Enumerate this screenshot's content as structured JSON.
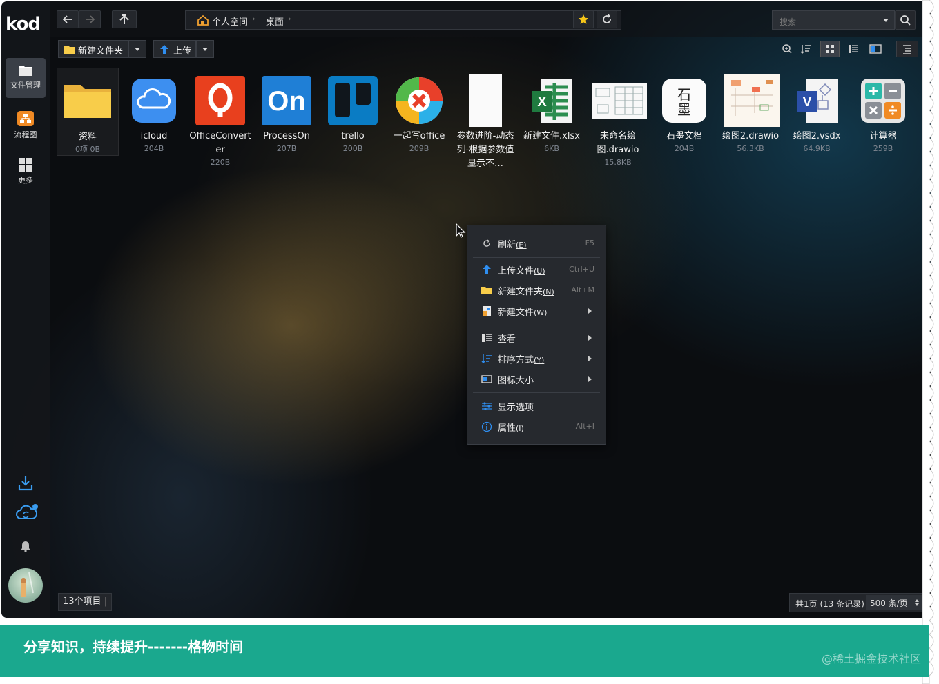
{
  "app": {
    "logo": "kod"
  },
  "sidebar": {
    "items": [
      {
        "label": "文件管理",
        "icon": "folder-icon"
      },
      {
        "label": "流程图",
        "icon": "flowchart-icon"
      },
      {
        "label": "更多",
        "icon": "grid-icon"
      }
    ],
    "bottom_icons": [
      "download-icon",
      "cloud-sync-icon",
      "bell-icon"
    ]
  },
  "breadcrumb": {
    "items": [
      "个人空间",
      "桌面"
    ]
  },
  "search": {
    "placeholder": "搜索"
  },
  "toolbar": {
    "new_folder": "新建文件夹",
    "upload": "上传"
  },
  "files": [
    {
      "name": "资料",
      "size": "0项 0B",
      "icon": "folder-icon"
    },
    {
      "name": "icloud",
      "size": "204B",
      "icon": "icloud-icon"
    },
    {
      "name": "OfficeConverter",
      "size": "220B",
      "icon": "officeconverter-icon"
    },
    {
      "name": "ProcessOn",
      "size": "207B",
      "icon": "processon-icon"
    },
    {
      "name": "trello",
      "size": "200B",
      "icon": "trello-icon"
    },
    {
      "name": "一起写office",
      "size": "209B",
      "icon": "yiqixie-icon"
    },
    {
      "name": "参数进阶-动态列-根据参数值显示不…",
      "size": "",
      "icon": "document-icon"
    },
    {
      "name": "新建文件.xlsx",
      "size": "6KB",
      "icon": "excel-icon"
    },
    {
      "name": "未命名绘图.drawio",
      "size": "15.8KB",
      "icon": "drawio-icon"
    },
    {
      "name": "石墨文档",
      "size": "204B",
      "icon": "shimo-icon"
    },
    {
      "name": "绘图2.drawio",
      "size": "56.3KB",
      "icon": "drawio-icon"
    },
    {
      "name": "绘图2.vsdx",
      "size": "64.9KB",
      "icon": "visio-icon"
    },
    {
      "name": "计算器",
      "size": "259B",
      "icon": "calculator-icon"
    }
  ],
  "context_menu": [
    {
      "label": "刷新",
      "accel": "(E)",
      "shortcut": "F5",
      "icon": "refresh-icon"
    },
    {
      "label": "上传文件",
      "accel": "(U)",
      "shortcut": "Ctrl+U",
      "icon": "upload-icon"
    },
    {
      "label": "新建文件夹",
      "accel": "(N)",
      "shortcut": "Alt+M",
      "icon": "folder-icon"
    },
    {
      "label": "新建文件",
      "accel": "(W)",
      "shortcut": "",
      "icon": "new-file-icon"
    },
    {
      "label": "查看",
      "accel": "",
      "shortcut": "",
      "icon": "view-icon"
    },
    {
      "label": "排序方式",
      "accel": "(Y)",
      "shortcut": "",
      "icon": "sort-icon"
    },
    {
      "label": "图标大小",
      "accel": "",
      "shortcut": "",
      "icon": "icon-size-icon"
    },
    {
      "label": "显示选项",
      "accel": "",
      "shortcut": "",
      "icon": "display-options-icon"
    },
    {
      "label": "属性",
      "accel": "(I)",
      "shortcut": "Alt+I",
      "icon": "info-icon"
    }
  ],
  "footer": {
    "count": "13个项目",
    "pager_text": "共1页 (13 条记录)",
    "per_page": "500 条/页"
  },
  "banner": {
    "slogan": "分享知识，持续提升-------格物时间",
    "watermark": "@稀土掘金技术社区"
  },
  "colors": {
    "banner": "#1aa88e",
    "accent_blue": "#2f8ef0",
    "folder_yellow": "#f8cd4a"
  }
}
